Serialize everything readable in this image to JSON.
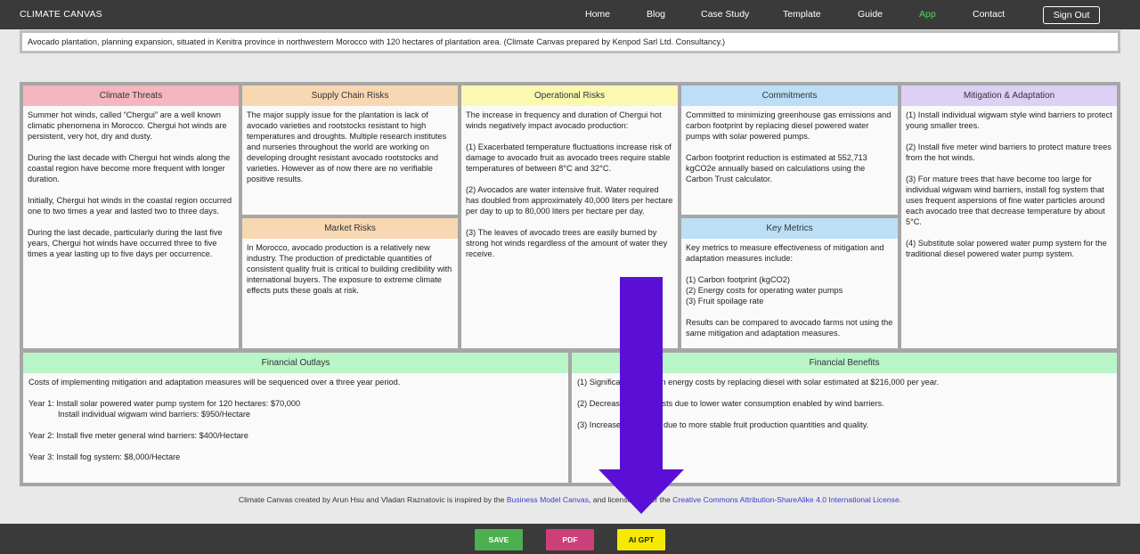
{
  "nav": {
    "brand": "CLIMATE CANVAS",
    "links": [
      "Home",
      "Blog",
      "Case Study",
      "Template",
      "Guide",
      "App",
      "Contact"
    ],
    "signout": "Sign Out"
  },
  "description": "Avocado plantation, planning expansion, situated in Kenitra province in northwestern Morocco with 120 hectares of plantation area.  (Climate Canvas prepared by Kenpod Sarl Ltd. Consultancy.)",
  "canvas": {
    "climate_threats": {
      "title": "Climate Threats",
      "color": "#f4b6c0",
      "paragraphs": [
        "Summer hot winds, called “Chergui” are a well known climatic phenomena in Morocco. Chergui hot winds are persistent, very hot, dry and dusty.",
        "During the last decade with Chergui hot winds along the coastal region have become more frequent with longer duration.",
        "Initially, Chergui hot winds in the coastal region occurred one to two times a year and lasted two to three days.",
        "During the last decade, particularly during the last five years, Chergui hot winds have occurred three to five times a year lasting up to five days per occurrence."
      ]
    },
    "supply_chain": {
      "title": "Supply Chain Risks",
      "color": "#f8d8b2",
      "paragraphs": [
        "The major supply issue for the plantation is lack of avocado varieties and rootstocks resistant to high temperatures and droughts. Multiple research institutes and nurseries throughout the world are working on developing drought resistant avocado rootstocks and varieties. However as of now there are no verifiable positive results."
      ]
    },
    "market_risks": {
      "title": "Market Risks",
      "color": "#f8d8b2",
      "paragraphs": [
        "In Morocco, avocado production is a relatively new industry. The production of predictable quantities of consistent quality fruit is critical to building credibility with international buyers.  The exposure to extreme climate effects puts these goals at risk."
      ]
    },
    "operational": {
      "title": "Operational Risks",
      "color": "#fbf8b0",
      "paragraphs": [
        "The increase in frequency and duration of Chergui hot winds negatively impact avocado production:",
        "(1) Exacerbated temperature fluctuations increase risk of damage to avocado fruit as avocado trees require stable temperatures of between 8°C and 32°C.",
        "(2) Avocados are water intensive fruit.  Water required has doubled from approximately 40,000 liters per hectare per day to up to 80,000 liters per hectare per day.",
        "(3) The leaves of avocado trees are easily burned by strong hot winds regardless of the amount of water they receive."
      ]
    },
    "commitments": {
      "title": "Commitments",
      "color": "#bcdff7",
      "paragraphs": [
        "Committed to minimizing greenhouse gas emissions and carbon footprint by replacing diesel powered water pumps with solar powered pumps.",
        "Carbon footprint reduction is estimated at 552,713 kgCO2e annually based on calculations using the Carbon Trust calculator."
      ]
    },
    "key_metrics": {
      "title": "Key Metrics",
      "color": "#bcdff7",
      "intro": "Key metrics to measure effectiveness of mitigation and adaptation measures include:",
      "items": [
        "(1) Carbon footprint (kgCO2)",
        "(2) Energy costs for operating water pumps",
        "(3) Fruit spoilage rate"
      ],
      "outro": "Results can be compared to avocado farms not using the same mitigation and adaptation measures."
    },
    "mitigation": {
      "title": "Mitigation & Adaptation",
      "color": "#ddd0f5",
      "paragraphs": [
        "(1) Install individual wigwam style wind barriers to protect young smaller trees.",
        "(2) Install five meter wind barriers to protect mature trees from the hot winds.",
        "(3) For mature trees that have become too large for individual wigwam wind barriers, install fog system that uses frequent aspersions of fine water particles around each avocado tree that decrease temperature by about 5°C.",
        "(4) Substitute solar powered water pump system for the traditional diesel powered water pump system."
      ]
    },
    "financial_outlays": {
      "title": "Financial Outlays",
      "color": "#b9f5c7",
      "intro": "Costs of implementing mitigation and adaptation measures will be sequenced over a three year period.",
      "year1_a": "Year 1:  Install solar powered water pump system for 120 hectares:  $70,000",
      "year1_b": "Install individual wigwam wind barriers:  $950/Hectare",
      "year2": "Year 2:  Install five meter general wind barriers:  $400/Hectare",
      "year3": "Year 3:  Install fog system:  $8,000/Hectare"
    },
    "financial_benefits": {
      "title": "Financial Benefits",
      "color": "#b9f5c7",
      "lines": [
        "(1)  Significant savings in energy costs by replacing diesel with solar estimated at $216,000 per year.",
        "(2)  Decreased water costs due to lower water consumption enabled by wind barriers.",
        "(3)  Increased revenues due to more stable fruit production quantities and quality."
      ]
    }
  },
  "credit": {
    "prefix": "Climate Canvas created by Arun Hsu and Vladan Raznatovic is inspired by the ",
    "link1": "Business Model Canvas",
    "middle": ", and licensed under the ",
    "link2": "Creative Commons Attribution-ShareAlike 4.0 International License",
    "suffix": "."
  },
  "buttons": {
    "save": "SAVE",
    "pdf": "PDF",
    "ai": "AI GPT"
  },
  "colors": {
    "nav_bg": "#3a3a3a",
    "active_link": "#4cd964",
    "arrow": "#5b0fd6",
    "save": "#4caf50",
    "pdf": "#cc3f7a",
    "ai": "#f5ea00"
  },
  "overlay": {
    "icon": "arrow-down-icon"
  }
}
